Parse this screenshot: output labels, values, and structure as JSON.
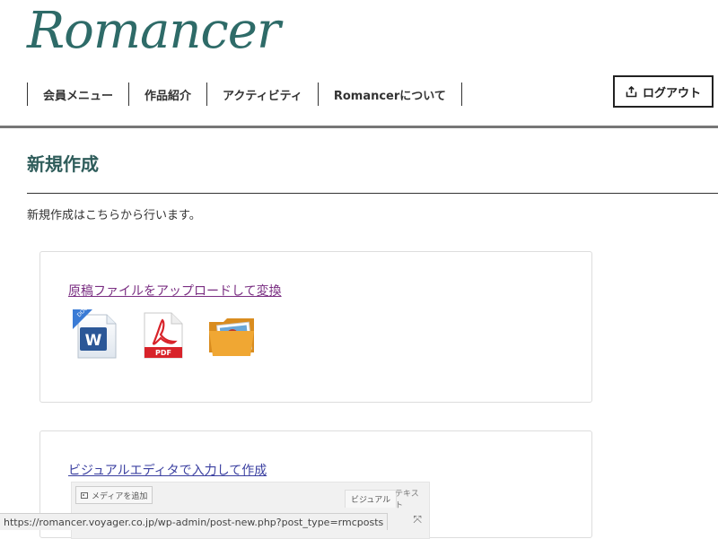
{
  "brand": {
    "logo_text": "Romancer"
  },
  "nav": {
    "items": [
      "会員メニュー",
      "作品紹介",
      "アクティビティ",
      "Romancerについて"
    ]
  },
  "header": {
    "logout_label": "ログアウト"
  },
  "main": {
    "page_title": "新規作成",
    "intro": "新規作成はこちらから行います。",
    "cards": [
      {
        "link": "原稿ファイルをアップロードして変換",
        "icons": [
          "word-docx-icon",
          "pdf-icon",
          "image-folder-icon"
        ]
      },
      {
        "link": "ビジュアルエディタで入力して作成",
        "editor": {
          "media_button": "メディアを追加",
          "tab_visual": "ビジュアル",
          "tab_text": "テキスト"
        }
      }
    ]
  },
  "status_bar": {
    "url": "https://romancer.voyager.co.jp/wp-admin/post-new.php?post_type=rmcposts"
  },
  "colors": {
    "brand": "#2e6b68",
    "visited_link": "#7a2e82",
    "link": "#3a3fa0"
  }
}
